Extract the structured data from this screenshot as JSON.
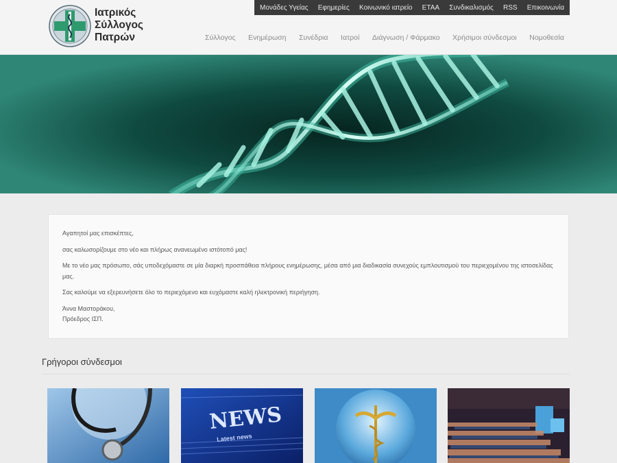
{
  "logo": {
    "line1": "Ιατρικός",
    "line2": "Σύλλογος",
    "line3": "Πατρών",
    "icon": "medical-cross-emblem"
  },
  "topbar": {
    "items": [
      "Μονάδες Υγείας",
      "Εφημερίες",
      "Κοινωνικό ιατρείο",
      "ΕΤΑΑ",
      "Συνδικαλισμός",
      "RSS",
      "Επικοινωνία"
    ]
  },
  "mainnav": {
    "items": [
      "Σύλλογος",
      "Ενημέρωση",
      "Συνέδρια",
      "Ιατροί",
      "Διάγνωση / Φάρμακο",
      "Χρήσιμοι σύνδεσμοι",
      "Νομοθεσία"
    ]
  },
  "hero": {
    "image": "dna-helix-banner"
  },
  "welcome": {
    "greeting": "Αγαπητοί μας επισκέπτες,",
    "p1": "σας καλωσορίζουμε στο νέο και πλήρως ανανεωμένο ιστότοπό μας!",
    "p2": "Με το νέο μας πρόσωπο, σάς υποδεχόμαστε σε μία διαρκή προσπάθεια πλήρους ενημέρωσης, μέσα από μια διαδικασία συνεχούς εμπλουτισμού του περιεχομένου της ιστοσελίδας μας.",
    "p3": "Σας καλούμε να εξερευνήσετε όλο το περιεχόμενο και ευχόμαστε καλή ηλεκτρονική περιήγηση.",
    "sig_name": "Άννα Μαστοράκου,",
    "sig_role": "Πρόεδρος ΙΣΠ."
  },
  "quick_links": {
    "title": "Γρήγοροι σύνδεσμοι",
    "cards": [
      {
        "image": "stethoscope-globe-image"
      },
      {
        "image": "news-image",
        "text": "NEWS",
        "subtext": "Latest news"
      },
      {
        "image": "caduceus-sphere-image"
      },
      {
        "image": "conference-hall-image"
      }
    ]
  },
  "colors": {
    "topbar": "#3a3a3a",
    "hero": "#2e7a6e",
    "page_bg": "#ececec"
  }
}
